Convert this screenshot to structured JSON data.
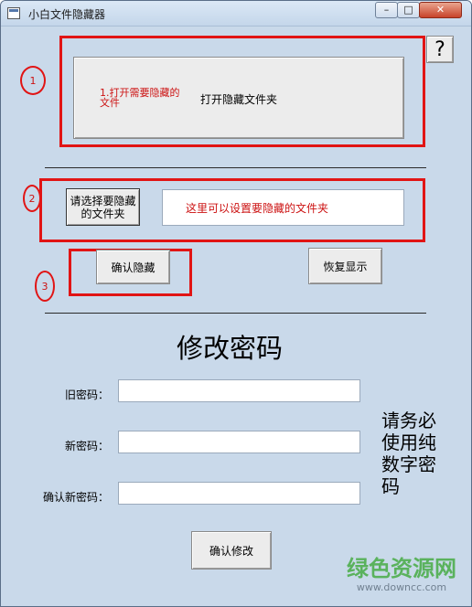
{
  "window": {
    "title": "小白文件隐藏器",
    "minimize": "0",
    "maximize": "1",
    "close": "r"
  },
  "help_button": "?",
  "step_markers": [
    "1",
    "2",
    "3"
  ],
  "step1": {
    "note": "1.打开需要隐藏的文件",
    "button": "打开隐藏文件夹"
  },
  "step2": {
    "choose_button": "请选择要隐藏的文件夹",
    "folder_hint": "这里可以设置要隐藏的文件夹"
  },
  "step3": {
    "confirm_hide": "确认隐藏",
    "restore_show": "恢复显示"
  },
  "password": {
    "heading": "修改密码",
    "old_label": "旧密码：",
    "new_label": "新密码：",
    "confirm_label": "确认新密码：",
    "notice": "请务必使用纯数字密码",
    "confirm_button": "确认修改"
  },
  "watermark": {
    "brand": "绿色资源网",
    "url": "www.downcc.com"
  },
  "colors": {
    "accent_red": "#e11414",
    "hint_red": "#cc1111",
    "window_bg": "#c9d9ea",
    "watermark_green": "#3fa93a"
  }
}
